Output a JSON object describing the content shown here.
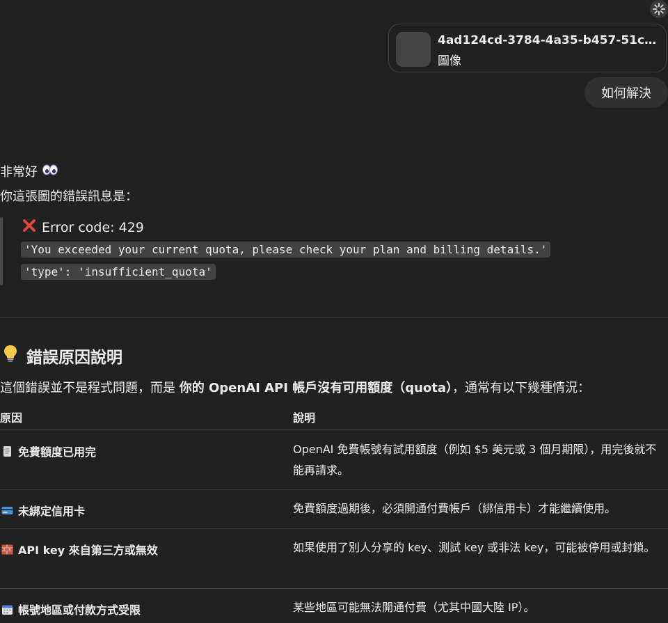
{
  "header": {
    "settings_icon": "loading-spinner-icon"
  },
  "attachment": {
    "file_name": "4ad124cd-3784-4a35-b457-51cad6...",
    "file_type": "圖像"
  },
  "user_message": {
    "text": "如何解決"
  },
  "assistant": {
    "greeting": "非常好",
    "greeting_icon": "eyes-icon",
    "intro_line": "你這張圖的錯誤訊息是：",
    "error": {
      "title": "Error code: 429",
      "message": "'You exceeded your current quota, please check your plan and billing details.'",
      "type": "'type': 'insufficient_quota'"
    },
    "section": {
      "icon": "lightbulb-icon",
      "title": "錯誤原因說明"
    },
    "explanation": {
      "prefix": "這個錯誤並不是程式問題，而是 ",
      "bold": "你的 OpenAI API 帳戶沒有可用額度（quota）",
      "suffix": "，通常有以下幾種情況："
    },
    "table": {
      "headers": [
        "原因",
        "說明"
      ],
      "rows": [
        {
          "icon": "receipt-icon",
          "reason": "免費額度已用完",
          "description": "OpenAI 免費帳號有試用額度（例如 $5 美元或 3 個月期限），用完後就不能再請求。"
        },
        {
          "icon": "credit-card-icon",
          "reason": "未綁定信用卡",
          "description": "免費額度過期後，必須開通付費帳戶（綁信用卡）才能繼續使用。"
        },
        {
          "icon": "brick-icon",
          "reason": "API key 來自第三方或無效",
          "description": "如果使用了別人分享的 key、測試 key 或非法 key，可能被停用或封鎖。"
        },
        {
          "icon": "calendar-icon",
          "reason": "帳號地區或付款方式受限",
          "description": "某些地區可能無法開通付費（尤其中國大陸 IP）。"
        }
      ]
    }
  },
  "colors": {
    "background": "#212121",
    "bubble": "#303030",
    "code_bg": "#424242",
    "error_red": "#e0483c"
  }
}
